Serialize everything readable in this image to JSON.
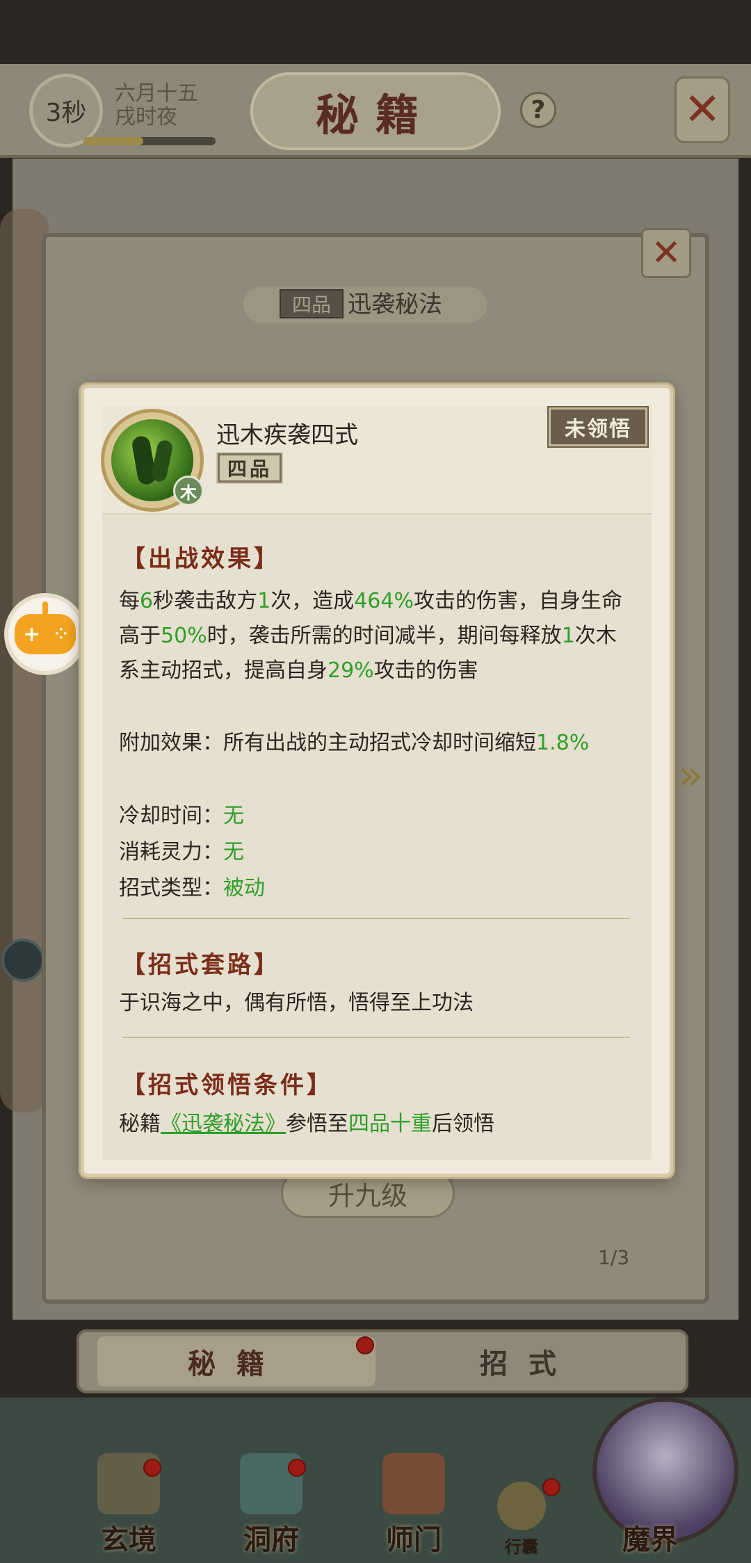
{
  "header": {
    "timer": "3秒",
    "date_line1": "六月十五",
    "date_line2": "戌时夜",
    "timer_progress": 0.45,
    "title": "秘籍",
    "help_icon": "?",
    "close_icon": "✕"
  },
  "book": {
    "grade": "四品",
    "title": "迅袭秘法",
    "levelup_label": "升九级",
    "page": "1/3",
    "close_icon": "✕"
  },
  "tabs": {
    "miji": "秘籍",
    "zhaoshi": "招式"
  },
  "nav": {
    "xuanjing": "玄境",
    "dongfu": "洞府",
    "shimen": "师门",
    "xingnang": "行囊",
    "mojie": "魔界"
  },
  "popup": {
    "skill_name": "迅木疾袭四式",
    "grade": "四品",
    "element": "木",
    "status": "未领悟",
    "battle_effect_title": "【出战效果】",
    "battle_effect": {
      "t1": "每",
      "v1": "6",
      "t2": "秒袭击敌方",
      "v2": "1",
      "t3": "次，造成",
      "v3": "464%",
      "t4": "攻击的伤害，自身生命高于",
      "v4": "50%",
      "t5": "时，袭击所需的时间减半，期间每释放",
      "v5": "1",
      "t6": "次木系主动招式，提高自身",
      "v6": "29%",
      "t7": "攻击的伤害"
    },
    "extra_effect": {
      "label": "附加效果：所有出战的主动招式冷却时间缩短",
      "value": "1.8%"
    },
    "cooldown_label": "冷却时间：",
    "cooldown_value": "无",
    "cost_label": "消耗灵力：",
    "cost_value": "无",
    "type_label": "招式类型：",
    "type_value": "被动",
    "routine_title": "【招式套路】",
    "routine_text": "于识海之中，偶有所悟，悟得至上功法",
    "condition_title": "【招式领悟条件】",
    "condition": {
      "prefix": "秘籍",
      "book_link": "《迅袭秘法》",
      "middle": "参悟至",
      "level": "四品十重",
      "suffix": "后领悟"
    }
  },
  "colors": {
    "highlight_green": "#2f9e2a",
    "section_title": "#7a2d18",
    "popup_bg": "#f0ebdd",
    "game_icon_orange": "#f3a31f"
  }
}
